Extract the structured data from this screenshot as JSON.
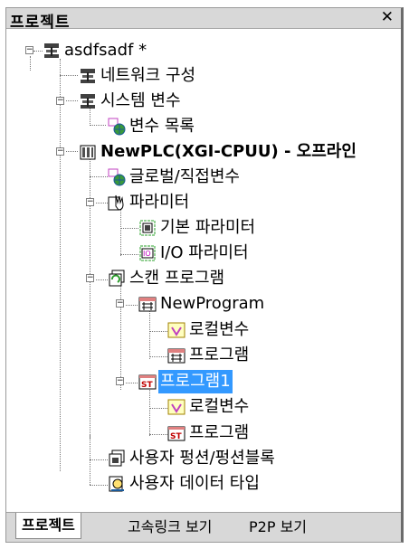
{
  "panel": {
    "title": "프로젝트",
    "close_icon": "close-icon"
  },
  "tree": {
    "project": "asdfsadf *",
    "network": "네트워크 구성",
    "system_vars": "시스템 변수",
    "var_list": "변수 목록",
    "plc": "NewPLC(XGI-CPUU) - 오프라인",
    "global_vars": "글로벌/직접변수",
    "parameters": "파라미터",
    "basic_param": "기본 파라미터",
    "io_param": "I/O 파라미터",
    "scan_program": "스캔 프로그램",
    "newprogram": "NewProgram",
    "local_vars_1": "로컬변수",
    "program_1": "프로그램",
    "program1": "프로그램1",
    "local_vars_2": "로컬변수",
    "program_2": "프로그램",
    "user_func": "사용자 펑션/펑션블록",
    "user_data_type": "사용자 데이터 타입"
  },
  "tabs": [
    "프로젝트",
    "고속링크 보기",
    "P2P 보기"
  ],
  "colors": {
    "selected": "#3399ff",
    "titlebar": "#d8d8d8"
  }
}
